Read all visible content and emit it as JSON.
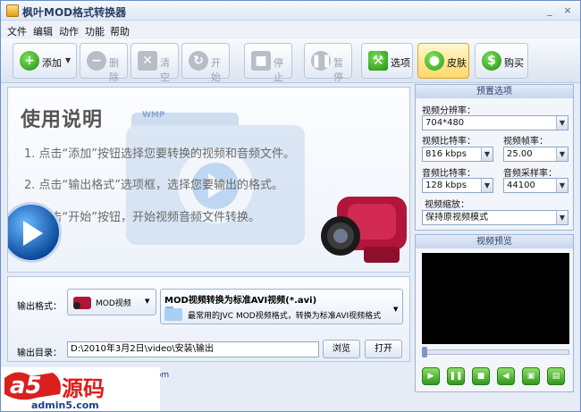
{
  "window": {
    "title": "枫叶MOD格式转换器",
    "minimize": "_",
    "close": "×"
  },
  "menu": [
    "文件",
    "编辑",
    "动作",
    "功能",
    "帮助"
  ],
  "toolbar": {
    "add": "添加",
    "add_arrow": "▼",
    "delete": "删除",
    "clear": "清空",
    "start": "开始",
    "stop": "停止",
    "pause": "暂停",
    "options": "选项",
    "skin": "皮肤",
    "buy": "购买"
  },
  "instructions": {
    "title": "使用说明",
    "line1": "1. 点击“添加”按钮选择您要转换的视频和音频文件。",
    "line2": "2. 点击“输出格式”选项框，选择您要输出的格式。",
    "line3": "3. 点击“开始”按钮，开始视频音频文件转换。",
    "folder_badge": "WMP"
  },
  "presets": {
    "header": "预置选项",
    "resolution_label": "视频分辨率：",
    "resolution": "704*480",
    "video_bitrate_label": "视频比特率：",
    "video_bitrate": "816 kbps",
    "framerate_label": "视频帧率：",
    "framerate": "25.00",
    "audio_bitrate_label": "音频比特率：",
    "audio_bitrate": "128 kbps",
    "samplerate_label": "音频采样率：",
    "samplerate": "44100",
    "scale_label": "视频缩放：",
    "scale": "保持原视频模式"
  },
  "preview": {
    "header": "视频预览",
    "seek_position": 0
  },
  "output": {
    "format_label": "输出格式：",
    "format_value": "MOD视频",
    "format_title": "MOD视频转换为标准AVI视频(*.avi)",
    "format_desc": "最常用的JVC MOD视频格式，转换为标准AVI视频格式",
    "dir_label": "输出目录：",
    "dir_value": "D:\\2010年3月2日\\video\\安装\\输出",
    "browse": "浏览",
    "open": "打开",
    "partial_text": ".com"
  },
  "watermark": {
    "logo": "a5",
    "brand": "源码",
    "site": "admin5.com"
  },
  "colors": {
    "accent": "#6b8fc9",
    "skin_active": "#ffd86a",
    "play_green": "#2f9a1a"
  }
}
